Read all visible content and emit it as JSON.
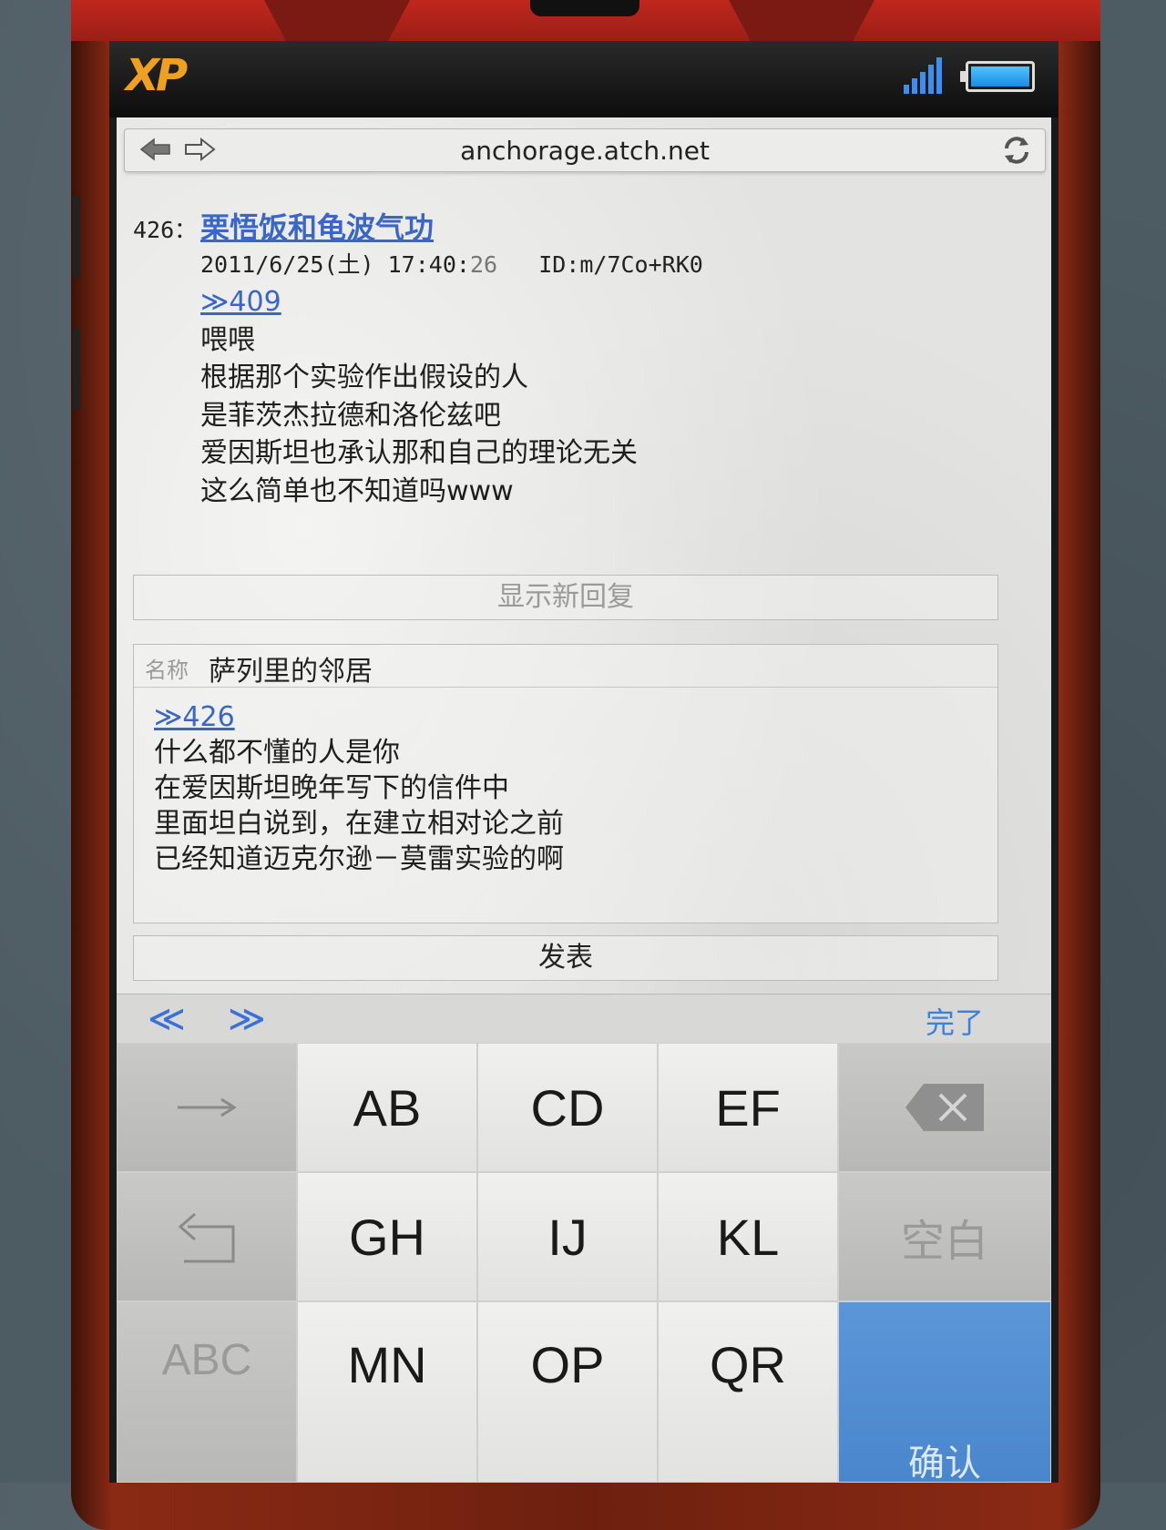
{
  "browser": {
    "url": "anchorage.atch.net"
  },
  "status": {
    "logo": "XP"
  },
  "post": {
    "number": "426：",
    "name": "栗悟饭和龟波气功",
    "date": "2011/6/25(土) 17:40:",
    "seconds": "26",
    "id": "ID:m/7Co+RK0",
    "reply_link": "≫409",
    "lines": [
      "喂喂",
      "根据那个实验作出假设的人",
      "是菲茨杰拉德和洛伦兹吧",
      "爱因斯坦也承认那和自己的理论无关",
      "这么简单也不知道吗www"
    ]
  },
  "new_reply_button": "显示新回复",
  "form": {
    "name_label": "名称",
    "name_value": "萨列里的邻居",
    "reply_link": "≫426",
    "lines": [
      "什么都不懂的人是你",
      "在爱因斯坦晚年写下的信件中",
      "里面坦白说到，在建立相对论之前",
      "已经知道迈克尔逊－莫雷实验的啊"
    ]
  },
  "submit_button": "发表",
  "keyboard_toolbar": {
    "prev": "≪",
    "next": "≫",
    "done": "完了"
  },
  "keyboard": {
    "row1": [
      "AB",
      "CD",
      "EF"
    ],
    "row2": [
      "GH",
      "IJ",
      "KL"
    ],
    "row3": [
      "MN",
      "OP",
      "QR"
    ],
    "space": "空白",
    "mode": "ABC",
    "confirm": "确认"
  },
  "colors": {
    "link": "#3a66c8",
    "accent": "#3a80e0",
    "logo": "#f0a020",
    "confirm_key": "#5b96d8",
    "phone_body": "#8a2a14"
  }
}
